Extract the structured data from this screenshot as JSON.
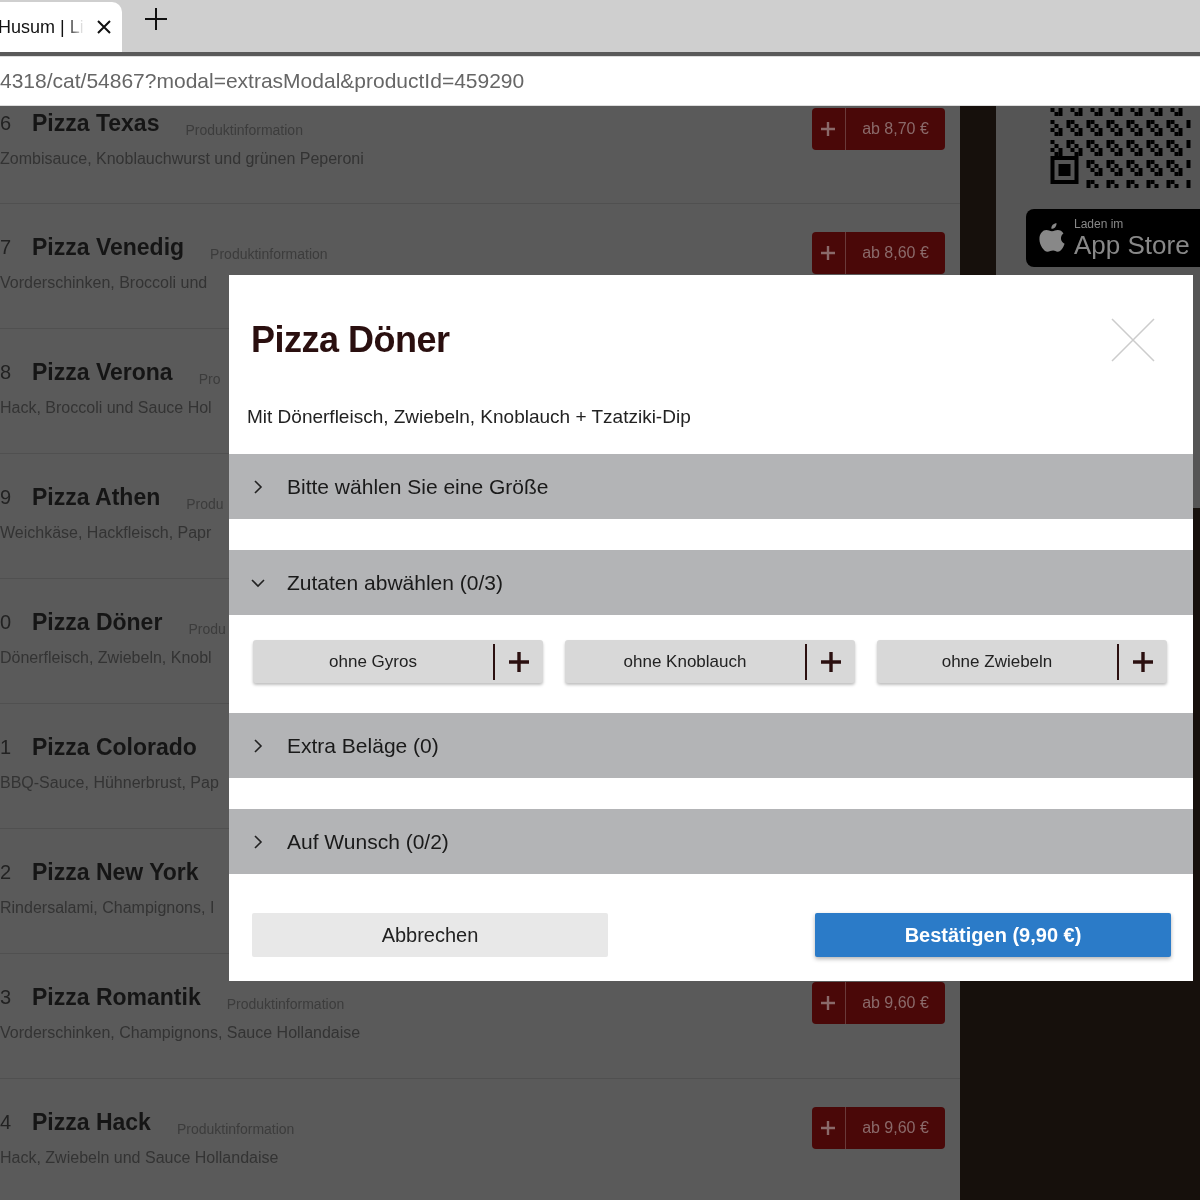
{
  "browser": {
    "tab_title": "Husum | Li",
    "url": "4318/cat/54867?modal=extrasModal&productId=459290"
  },
  "menu": {
    "rows": [
      {
        "number": "6",
        "name": "Pizza Texas",
        "info": "Produktinformation",
        "description": "Zombisauce, Knoblauchwurst und grünen Peperoni",
        "price": "ab 8,70 €"
      },
      {
        "number": "7",
        "name": "Pizza Venedig",
        "info": "Produktinformation",
        "description": "Vorderschinken, Broccoli und",
        "price": "ab 8,60 €"
      },
      {
        "number": "8",
        "name": "Pizza Verona",
        "info": "Pro",
        "description": "Hack, Broccoli und Sauce Hol"
      },
      {
        "number": "9",
        "name": "Pizza Athen",
        "info": "Produ",
        "description": "Weichkäse, Hackfleisch, Papr"
      },
      {
        "number": "0",
        "name": "Pizza Döner",
        "info": "Produ",
        "description": "Dönerfleisch, Zwiebeln, Knobl"
      },
      {
        "number": "1",
        "name": "Pizza Colorado",
        "description": "BBQ-Sauce, Hühnerbrust, Pap"
      },
      {
        "number": "2",
        "name": "Pizza New York",
        "description": "Rindersalami, Champignons, I"
      },
      {
        "number": "3",
        "name": "Pizza Romantik",
        "info": "Produktinformation",
        "description": "Vorderschinken, Champignons, Sauce Hollandaise",
        "price": "ab 9,60 €"
      },
      {
        "number": "4",
        "name": "Pizza Hack",
        "info": "Produktinformation",
        "description": "Hack, Zwiebeln und Sauce Hollandaise",
        "price": "ab 9,60 €"
      }
    ]
  },
  "app_store": {
    "small": "Laden im",
    "big": "App Store"
  },
  "modal": {
    "title": "Pizza Döner",
    "description": "Mit Dönerfleisch, Zwiebeln, Knoblauch + Tzatziki-Dip",
    "sections": [
      {
        "label": "Bitte wählen Sie eine Größe",
        "expanded": false
      },
      {
        "label": "Zutaten abwählen (0/3)",
        "expanded": true,
        "options": [
          "ohne Gyros",
          "ohne Knoblauch",
          "ohne Zwiebeln"
        ]
      },
      {
        "label": "Extra Beläge (0)",
        "expanded": false
      },
      {
        "label": "Auf Wunsch (0/2)",
        "expanded": false
      }
    ],
    "cancel": "Abbrechen",
    "confirm": "Bestätigen (9,90 €)"
  }
}
